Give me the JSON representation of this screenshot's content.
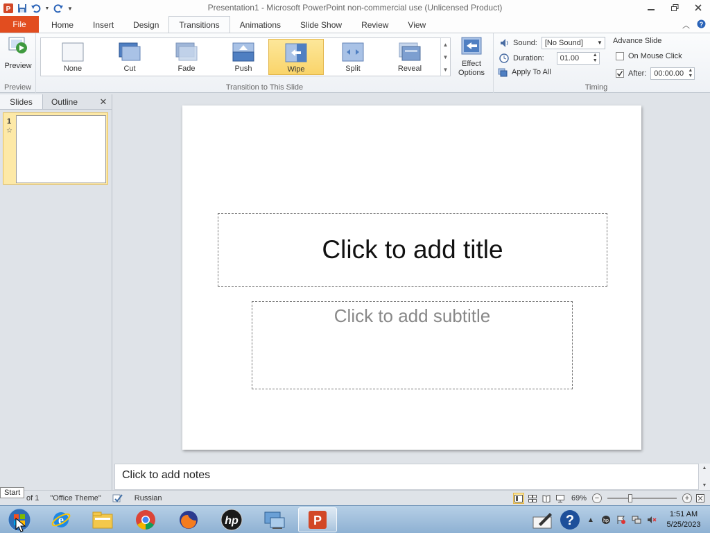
{
  "window": {
    "title": "Presentation1  -  Microsoft PowerPoint non-commercial use (Unlicensed Product)"
  },
  "quick_access": {
    "icons": [
      "powerpoint-icon",
      "save-icon",
      "undo-icon",
      "redo-icon",
      "customize-icon"
    ]
  },
  "tabs": {
    "file": "File",
    "items": [
      "Home",
      "Insert",
      "Design",
      "Transitions",
      "Animations",
      "Slide Show",
      "Review",
      "View"
    ],
    "active": "Transitions"
  },
  "ribbon": {
    "preview": {
      "label": "Preview",
      "group_label": "Preview"
    },
    "transitions": {
      "group_label": "Transition to This Slide",
      "items": [
        "None",
        "Cut",
        "Fade",
        "Push",
        "Wipe",
        "Split",
        "Reveal"
      ],
      "selected": "Wipe",
      "effect_options": "Effect Options"
    },
    "timing": {
      "group_label": "Timing",
      "sound_label": "Sound:",
      "sound_value": "[No Sound]",
      "duration_label": "Duration:",
      "duration_value": "01.00",
      "apply_all": "Apply To All",
      "advance_label": "Advance Slide",
      "on_mouse_click": "On Mouse Click",
      "on_mouse_click_checked": false,
      "after_label": "After:",
      "after_value": "00:00.00",
      "after_checked": true
    }
  },
  "slides_pane": {
    "tabs": [
      "Slides",
      "Outline"
    ],
    "active_tab": "Slides",
    "slides": [
      {
        "number": "1"
      }
    ]
  },
  "slide": {
    "title_placeholder": "Click to add title",
    "subtitle_placeholder": "Click to add subtitle"
  },
  "notes": {
    "placeholder": "Click to add notes"
  },
  "statusbar": {
    "slide_info": "of 1",
    "theme": "\"Office Theme\"",
    "language": "Russian",
    "zoom": "69%",
    "zoom_level_percent": 69
  },
  "start_tooltip": "Start",
  "taskbar": {
    "apps": [
      "windows-start-icon",
      "internet-explorer-icon",
      "file-explorer-icon",
      "chrome-icon",
      "firefox-icon",
      "hp-icon",
      "remote-desktop-icon",
      "powerpoint-icon"
    ],
    "active_app": "powerpoint-icon"
  },
  "clock": {
    "time": "1:51 AM",
    "date": "5/25/2023"
  },
  "colors": {
    "file_tab": "#e24d1f",
    "selected_item": "#f9d46a",
    "taskbar": "#8eb1d3"
  }
}
